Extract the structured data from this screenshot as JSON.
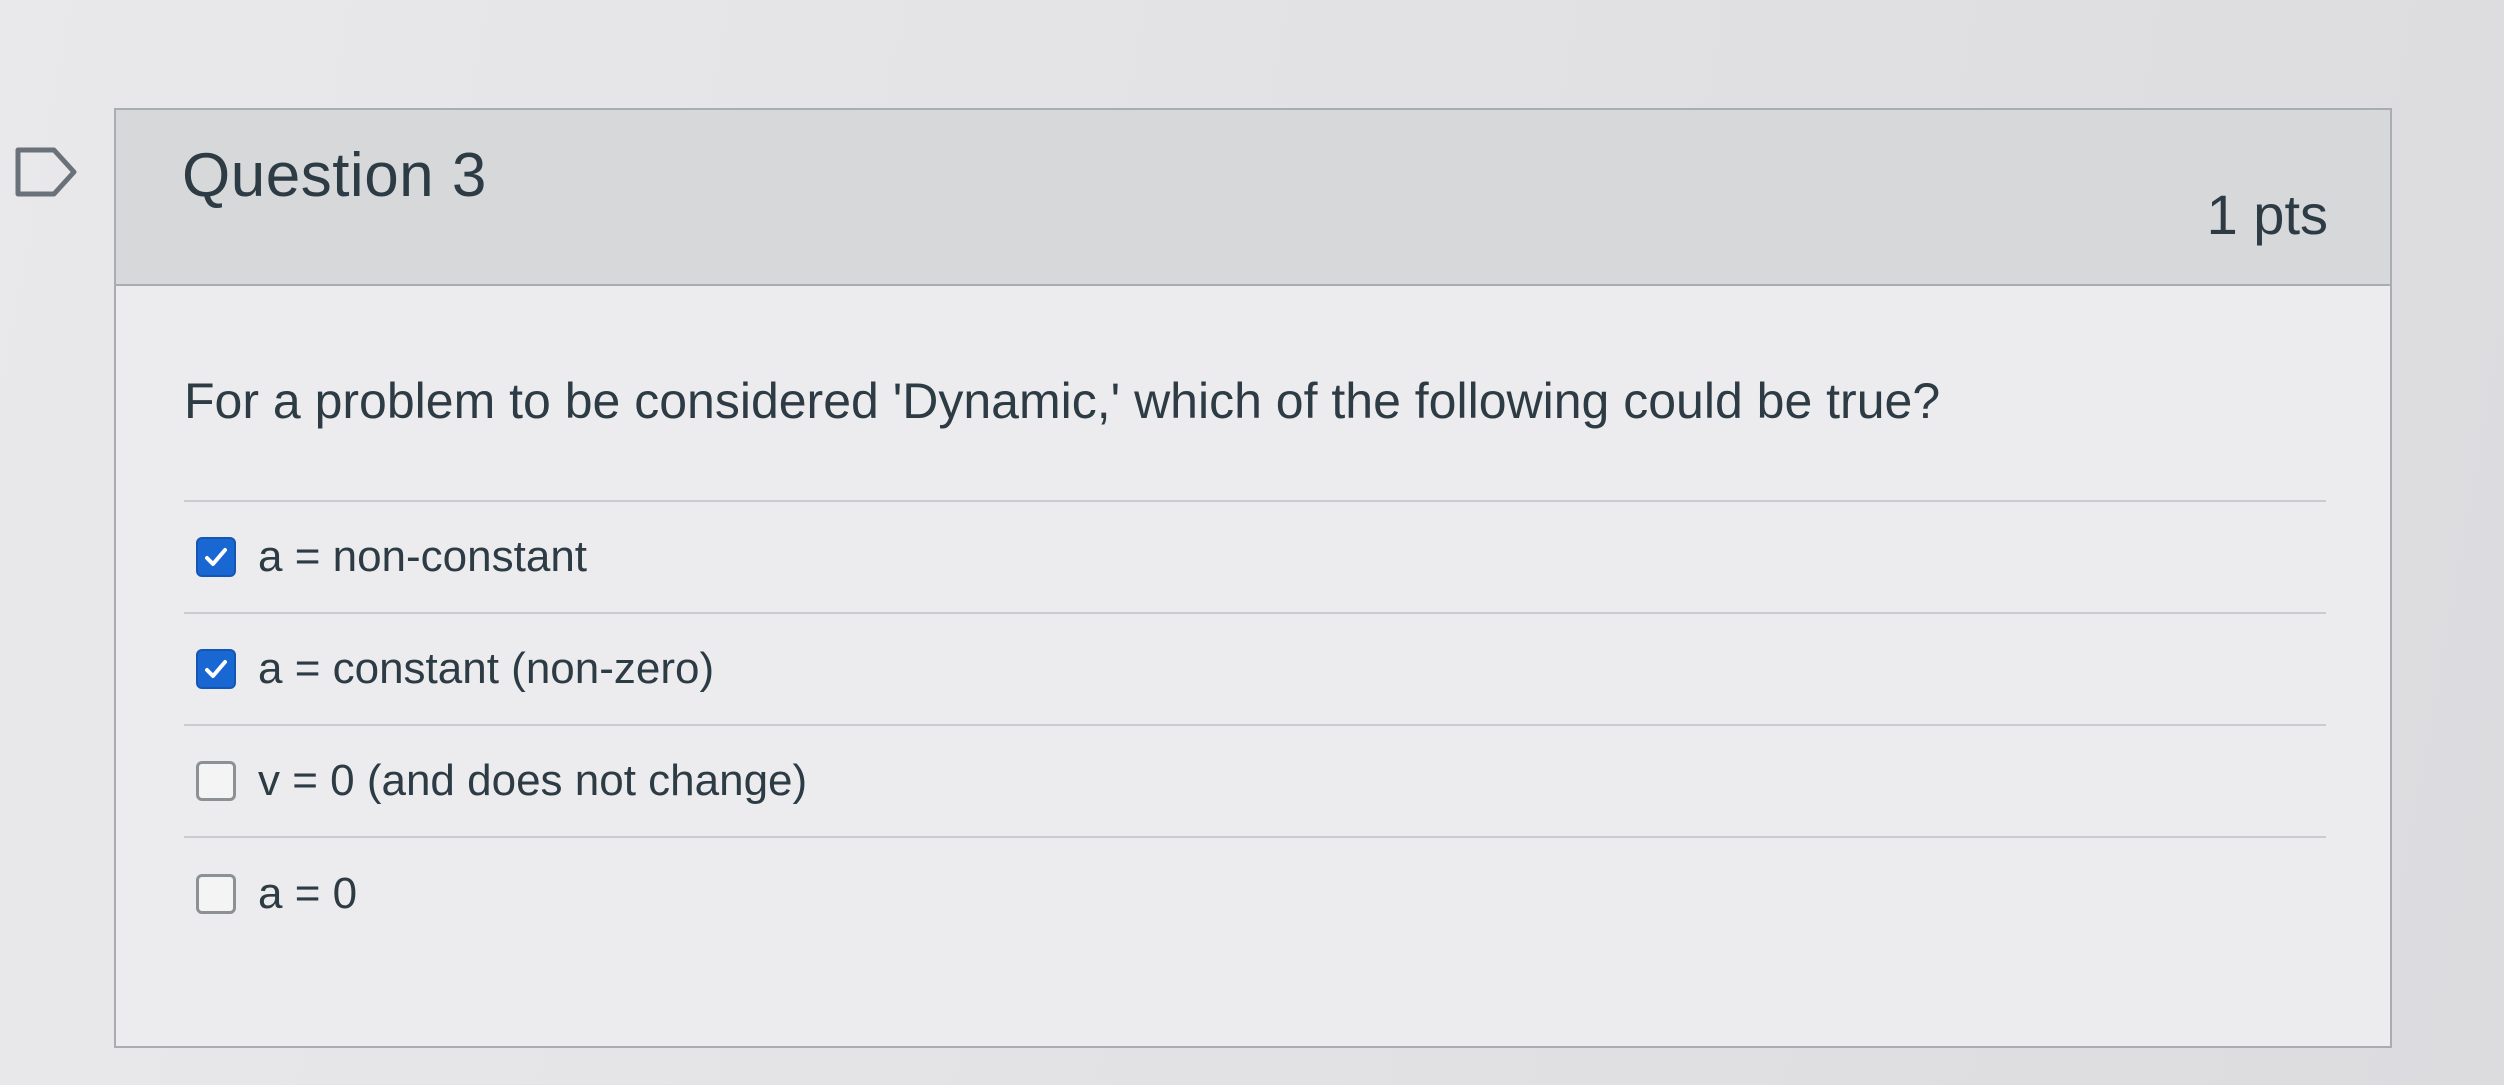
{
  "question": {
    "title": "Question 3",
    "points": "1 pts",
    "text": "For a problem to be considered 'Dynamic,' which of the following could be true?"
  },
  "answers": [
    {
      "label": "a = non-constant",
      "checked": true
    },
    {
      "label": "a = constant (non-zero)",
      "checked": true
    },
    {
      "label": "v = 0 (and does not change)",
      "checked": false
    },
    {
      "label": "a = 0",
      "checked": false
    }
  ],
  "colors": {
    "checkbox_checked": "#1967d2",
    "header_background": "#d7d8da",
    "text": "#2d3b45"
  },
  "icons": {
    "flag": "flag-question-icon",
    "check": "checkmark-icon"
  }
}
